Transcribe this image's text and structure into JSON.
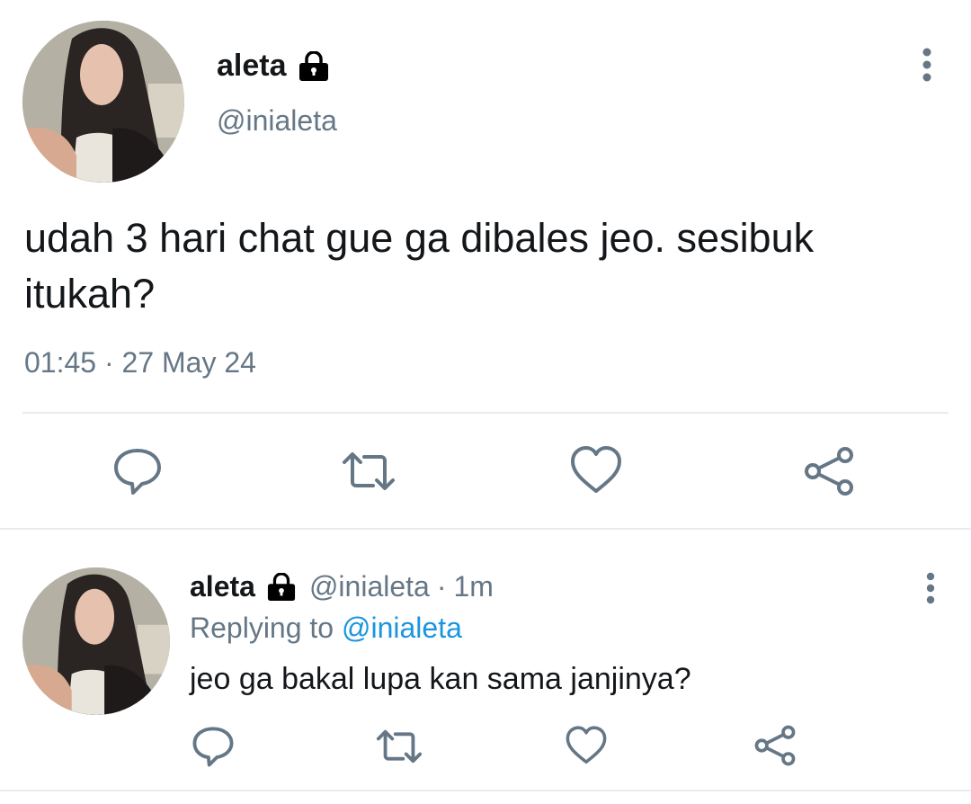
{
  "main_tweet": {
    "display_name": "aleta",
    "handle": "@inialeta",
    "text": "udah 3 hari chat gue ga dibales jeo. sesibuk itukah?",
    "timestamp": "01:45 · 27 May 24",
    "icons": {
      "lock": "lock-icon",
      "more": "more-vertical-icon",
      "reply": "reply-icon",
      "retweet": "retweet-icon",
      "like": "heart-icon",
      "share": "share-icon"
    }
  },
  "reply_tweet": {
    "display_name": "aleta",
    "handle": "@inialeta",
    "separator": "·",
    "age": "1m",
    "replying_prefix": "Replying to",
    "replying_to": "@inialeta",
    "text": "jeo ga bakal lupa kan sama janjinya?"
  },
  "colors": {
    "text": "#14171a",
    "muted": "#657786",
    "link": "#1b95e0",
    "divider": "#e6ecf0"
  }
}
